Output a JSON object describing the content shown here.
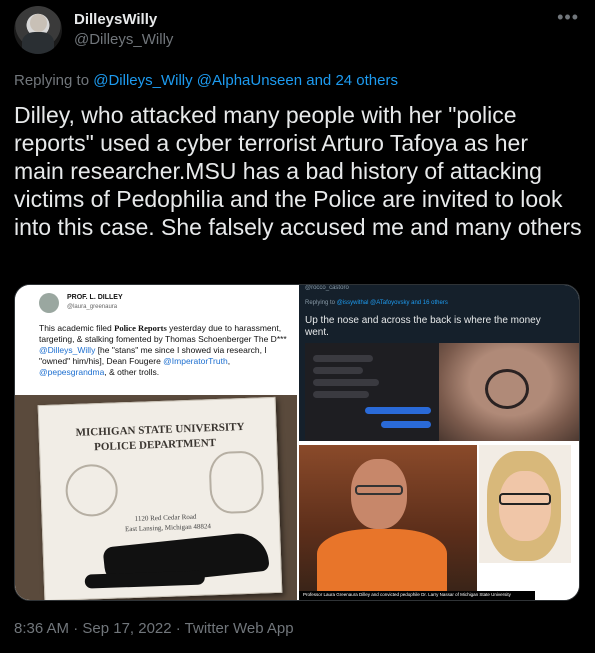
{
  "tweet": {
    "author_name": "DilleysWilly",
    "author_handle": "@Dilleys_Willy",
    "more_icon": "more-horizontal-icon",
    "replying_prefix": "Replying to",
    "replying_to": "@Dilleys_Willy @AlphaUnseen and 24 others",
    "text": "Dilley, who attacked many people with her \"police reports\" used a cyber terrorist Arturo Tafoya as her main researcher.MSU has a bad history of attacking victims of Pedophilia and the Police are invited to look into this case. She falsely accused me and many others",
    "timestamp": "8:36 AM · Sep 17, 2022 · Twitter Web App"
  },
  "media": {
    "left": {
      "name": "PROF. L. DILLEY",
      "handle": "@laura_greenaura",
      "text_before": "This academic filed ",
      "text_bold": "Police Reports",
      "text_mid": " yesterday due to harassment, targeting, & stalking fomented by Thomas Schoenberger The D*** ",
      "mention1": "@Dilleys_Willy",
      "text_mid2": " [he \"stans\" me since I showed via research, I \"owned\" him/his], Dean Fougere ",
      "mention2": "@ImperatorTruth",
      "text_sep": ", ",
      "mention3": "@pepesgrandma",
      "text_end": ", & other trolls.",
      "card_line1": "MICHIGAN STATE UNIVERSITY",
      "card_line2": "POLICE DEPARTMENT",
      "card_addr1": "1120 Red Cedar Road",
      "card_addr2": "East Lansing, Michigan 48824"
    },
    "right_top": {
      "top_handle": "@rocco_castoro",
      "replying_prefix": "Replying to",
      "replying_to": "@issywithal @ATafoyovsky and 16 others",
      "text": "Up the nose and across the back is where the money went."
    },
    "right_bottom": {
      "caption": "Professor Laura Greenaura Dilley and convicted pedophile Dr. Larry Nassar of Michigan State University"
    }
  }
}
